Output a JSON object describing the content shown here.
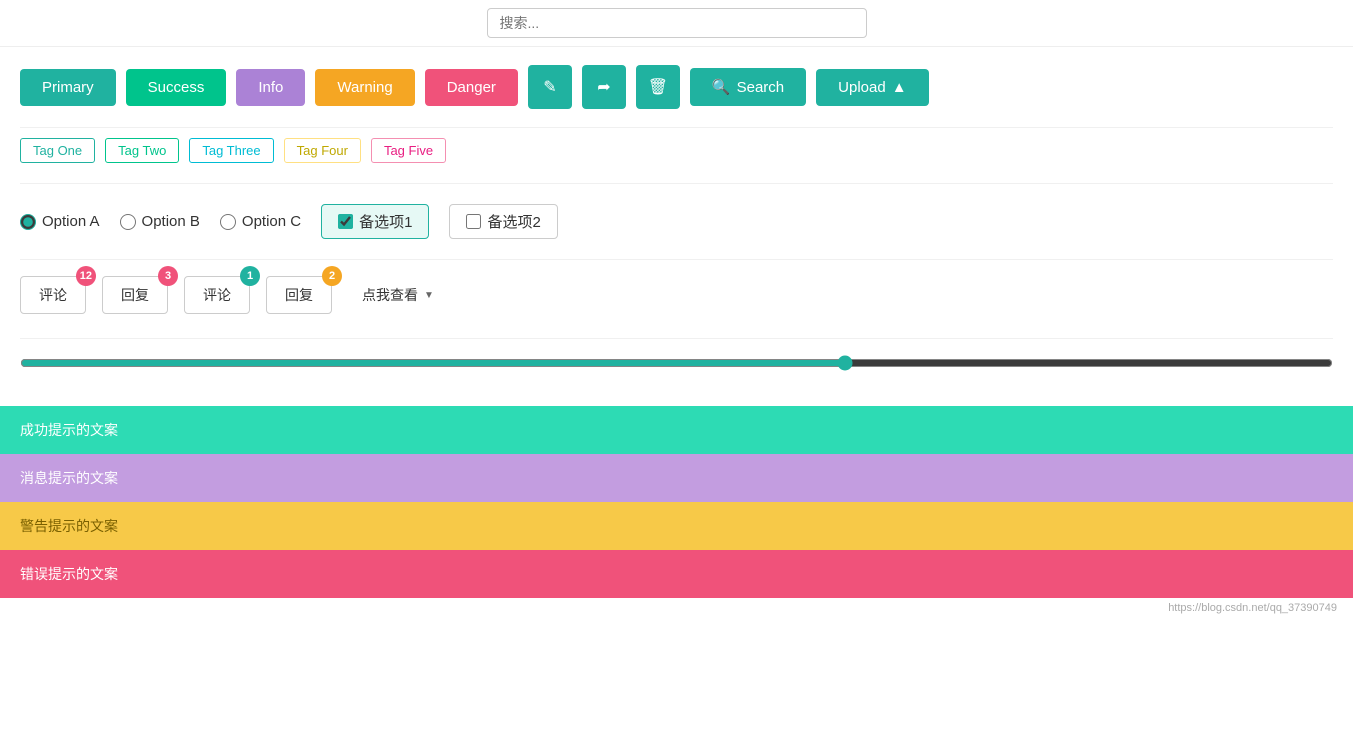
{
  "topSearch": {
    "placeholder": "搜索..."
  },
  "buttons": {
    "primary": "Primary",
    "success": "Success",
    "info": "Info",
    "warning": "Warning",
    "danger": "Danger",
    "search": "Search",
    "upload": "Upload",
    "editIcon": "✎",
    "shareIcon": "⤢",
    "deleteIcon": "🗑"
  },
  "tags": [
    {
      "id": "tag-one",
      "label": "Tag One",
      "class": "tag-one"
    },
    {
      "id": "tag-two",
      "label": "Tag Two",
      "class": "tag-two"
    },
    {
      "id": "tag-three",
      "label": "Tag Three",
      "class": "tag-three"
    },
    {
      "id": "tag-four",
      "label": "Tag Four",
      "class": "tag-four"
    },
    {
      "id": "tag-five",
      "label": "Tag Five",
      "class": "tag-five"
    }
  ],
  "options": {
    "radioA": "Option A",
    "radioB": "Option B",
    "radioC": "Option C",
    "checkboxChecked": "备选项1",
    "checkboxUnchecked": "备选项2"
  },
  "badges": {
    "btn1_label": "评论",
    "btn1_count": "12",
    "btn2_label": "回复",
    "btn2_count": "3",
    "btn3_label": "评论",
    "btn3_count": "1",
    "btn4_label": "回复",
    "btn4_count": "2",
    "dropdown_label": "点我查看"
  },
  "slider": {
    "value": 63,
    "min": 0,
    "max": 100
  },
  "alerts": {
    "success": "成功提示的文案",
    "info": "消息提示的文案",
    "warning": "警告提示的文案",
    "danger": "错误提示的文案"
  },
  "attribution": "https://blog.csdn.net/qq_37390749"
}
